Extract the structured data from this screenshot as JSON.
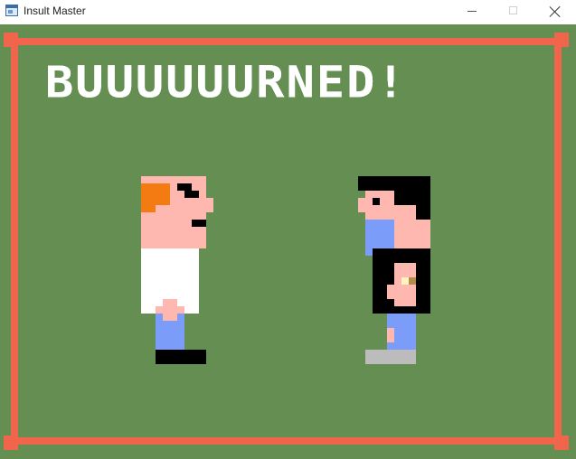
{
  "window": {
    "title": "Insult Master",
    "icon": "app-window-icon",
    "controls": [
      "minimize",
      "maximize",
      "close"
    ]
  },
  "game": {
    "banner": "BUUUUUURNED!",
    "colors": {
      "background": "#648e52",
      "frame": "#f0654c",
      "banner_text": "#ffffff",
      "skin": "#ffb8b0",
      "hair_orange": "#f47a12",
      "shirt_white": "#ffffff",
      "pants_blue": "#7b9cf8",
      "shoe_black": "#000000",
      "hair_black": "#000000",
      "shoe_gray": "#bcbcbc"
    },
    "characters": [
      {
        "name": "player-character",
        "description": "orange-haired fighter facing right"
      },
      {
        "name": "opponent-character",
        "description": "black-haired fighter facing left"
      }
    ]
  }
}
